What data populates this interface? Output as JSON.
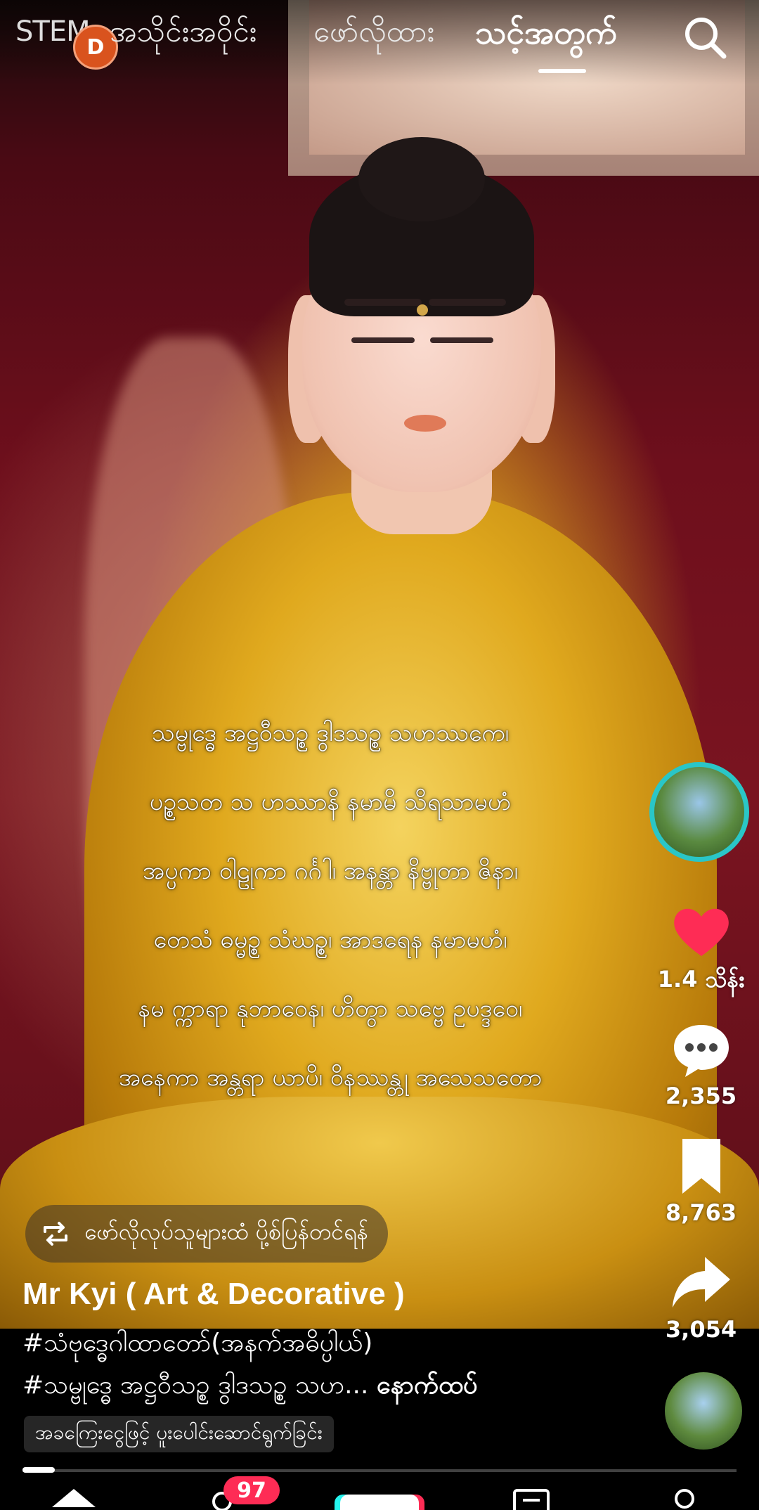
{
  "top_nav": {
    "left_label": "STEM",
    "live_badge": "D",
    "tabs": [
      {
        "label": "အသိုင်းအဝိုင်း",
        "active": false
      },
      {
        "label": "ဖော်လိုထား",
        "active": false
      },
      {
        "label": "သင့်အတွက်",
        "active": true
      }
    ],
    "search_icon": "search-icon"
  },
  "video": {
    "verses": [
      "သမ္ဗုဒ္ဓေ အဋ္ဌဝီသဉ္စ ဒွါဒသဉ္စ သဟဿကေ၊",
      "ပဉ္စသတ သ ဟဿာနိ နမာမိ သိရသာမဟံ",
      "အပ္ပကာ ဝါဠုကာ ဂင်္ဂါ၊ အနန္တာ နိဗ္ဗုတာ ဇိနာ၊",
      "တေသံ ဓမ္မဉ္စ သံဃဉ္စ၊ အာဒရေန နမာမဟံ၊",
      "နမ က္ကာရာ နုဘာဝေန၊ ဟိတွာ သဗ္ဗေ ဥပဒ္ဒဝေ၊",
      "အနေကာ အန္တရာ ယာပိ၊ ဝိနဿန္တု အသေသတော"
    ]
  },
  "right_rail": {
    "avatar_icon": "user-avatar",
    "like_count": "1.4 သိန်း",
    "comment_count": "2,355",
    "bookmark_count": "8,763",
    "share_count": "3,054",
    "like_color": "#fe2c55"
  },
  "repost_chip": {
    "label": "ဖော်လိုလုပ်သူများထံ ပို့စ်ပြန်တင်ရန်"
  },
  "caption": {
    "author": "Mr Kyi ( Art & Decorative )",
    "line1": "#သံဗုဒ္ဓေဂါထာတော်(အနက်အဓိပ္ပါယ်)",
    "line2": "#သမ္ဗုဒ္ဓေ အဋ္ဌဝီသဉ္စ ဒွါဒသဉ္စ သဟ...",
    "more": "နောက်ထပ်",
    "anchor": "အခကြေးငွေဖြင့် ပူးပေါင်းဆောင်ရွက်ခြင်း"
  },
  "bottom_nav": {
    "inbox_badge": "97"
  },
  "colors": {
    "accent_cyan": "#25f4ee",
    "accent_red": "#fe2c55",
    "avatar_ring": "#2ac6c7"
  }
}
